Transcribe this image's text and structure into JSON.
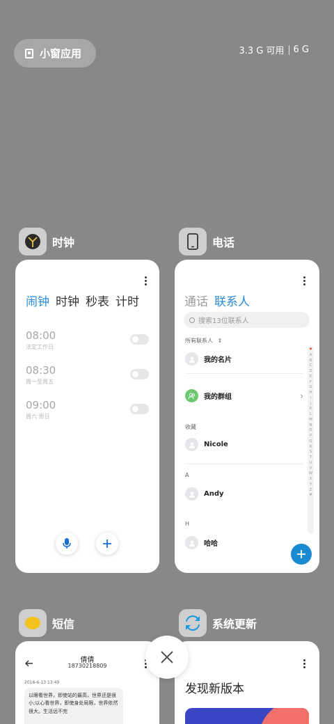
{
  "top": {
    "mini_window_label": "小窗应用",
    "memory_available": "3.3 G 可用",
    "memory_total": "6 G"
  },
  "apps": {
    "clock": {
      "name": "时钟",
      "tabs": [
        "闹钟",
        "时钟",
        "秒表",
        "计时"
      ],
      "alarms": [
        {
          "time": "08:00",
          "sub": "法定工作日"
        },
        {
          "time": "08:30",
          "sub": "周一至周五"
        },
        {
          "time": "09:00",
          "sub": "周六 周日"
        }
      ]
    },
    "phone": {
      "name": "电话",
      "tabs": [
        "通话",
        "联系人"
      ],
      "search_placeholder": "搜索13位联系人",
      "all_contacts_label": "所有联系人",
      "my_card": "我的名片",
      "my_groups": "我的群组",
      "favorites_label": "收藏",
      "contacts": [
        {
          "section": "",
          "name": "Nicole"
        },
        {
          "section": "A",
          "name": "Andy"
        },
        {
          "section": "H",
          "name": "哈哈"
        }
      ],
      "alphabet": [
        "♥",
        "A",
        "B",
        "C",
        "D",
        "E",
        "F",
        "G",
        "H",
        "I",
        "J",
        "K",
        "L",
        "M",
        "N",
        "O",
        "P",
        "Q",
        "R",
        "S",
        "T",
        "U",
        "V",
        "W",
        "X",
        "Y",
        "Z",
        "#"
      ]
    },
    "sms": {
      "name": "短信",
      "contact_name": "倩倩",
      "contact_number": "18730218809",
      "date": "2016-6-13 13:49",
      "message": "以眼看世界，即使站的最高，世界还是很小;以心看世界，即使身处局限，世界依然很大。生活远不完"
    },
    "update": {
      "name": "系统更新",
      "title": "发现新版本"
    }
  },
  "colors": {
    "background": "#888888",
    "accent_blue": "#2a8bd8",
    "fab_blue": "#1a8ad3",
    "group_green": "#6dc870"
  }
}
